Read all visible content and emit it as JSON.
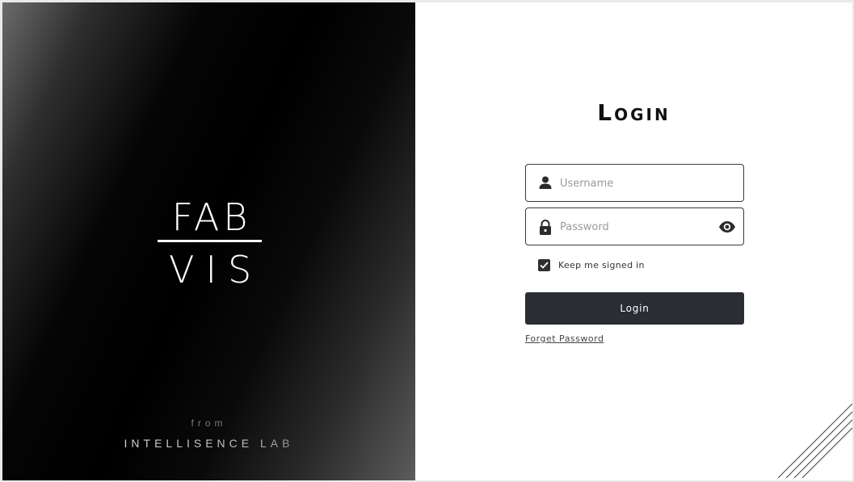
{
  "brand": {
    "logo_top": "FAB",
    "logo_bottom": "VIS",
    "from_text": "from",
    "lab_text": "INTELLISENCE LAB"
  },
  "login": {
    "title": "Login",
    "username_placeholder": "Username",
    "username_value": "",
    "password_placeholder": "Password",
    "password_value": "",
    "keep_signed_in_label": "Keep me signed in",
    "keep_signed_in_checked": true,
    "submit_label": "Login",
    "forget_link": "Forget Password"
  },
  "icons": {
    "username": "user-icon",
    "password": "lock-icon",
    "toggle_password": "eye-icon",
    "checkbox": "checkmark-icon"
  },
  "colors": {
    "button_bg": "#2a2d33",
    "checkbox_bg": "#2d2f33",
    "field_border": "#3a3a3a"
  }
}
